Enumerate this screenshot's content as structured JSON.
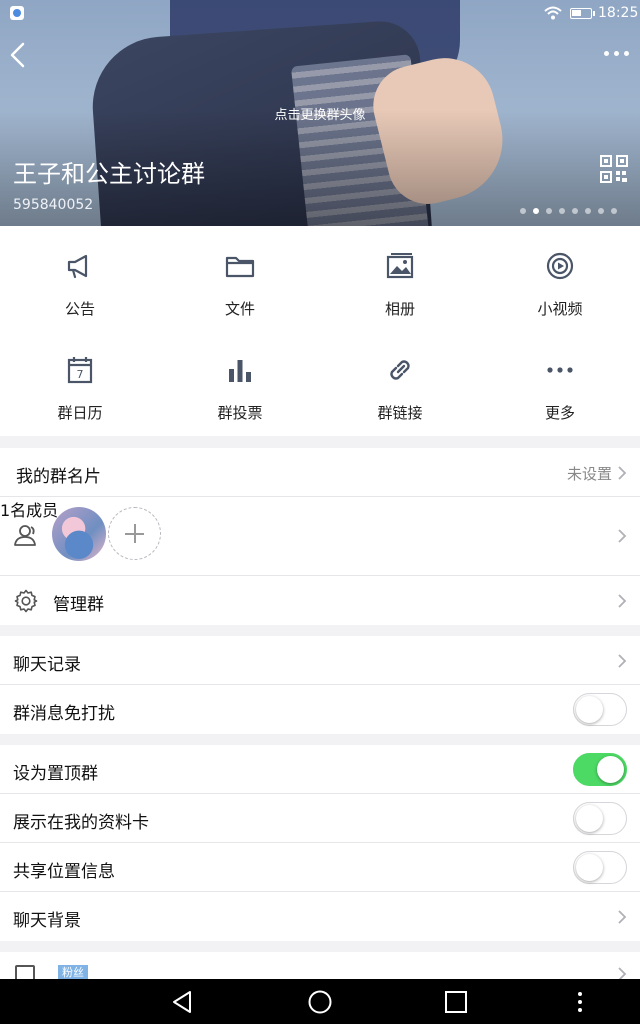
{
  "status_bar": {
    "time": "18:25"
  },
  "header": {
    "change_avatar_hint": "点击更换群头像",
    "group_name": "王子和公主讨论群",
    "group_id": "595840052",
    "page_dots_count": 8,
    "active_dot_index": 1
  },
  "grid": [
    {
      "label": "公告",
      "icon": "megaphone-icon"
    },
    {
      "label": "文件",
      "icon": "folder-icon"
    },
    {
      "label": "相册",
      "icon": "photo-album-icon"
    },
    {
      "label": "小视频",
      "icon": "video-icon"
    },
    {
      "label": "群日历",
      "icon": "calendar-icon"
    },
    {
      "label": "群投票",
      "icon": "bar-chart-icon"
    },
    {
      "label": "群链接",
      "icon": "link-icon"
    },
    {
      "label": "更多",
      "icon": "more-dots-icon"
    }
  ],
  "calendar_day": "7",
  "card": {
    "label": "我的群名片",
    "value": "未设置"
  },
  "members": {
    "count_text": "1名成员"
  },
  "manage": {
    "label": "管理群"
  },
  "chat_settings": {
    "history": "聊天记录",
    "mute": "群消息免打扰",
    "mute_on": false
  },
  "prefs": {
    "pin": "设为置顶群",
    "pin_on": true,
    "show_card": "展示在我的资料卡",
    "show_card_on": false,
    "share_location": "共享位置信息",
    "share_location_on": false,
    "background": "聊天背景"
  },
  "fans": {
    "badge": "粉丝"
  },
  "colors": {
    "toggle_on": "#4cd964",
    "accent": "#4a5568"
  }
}
